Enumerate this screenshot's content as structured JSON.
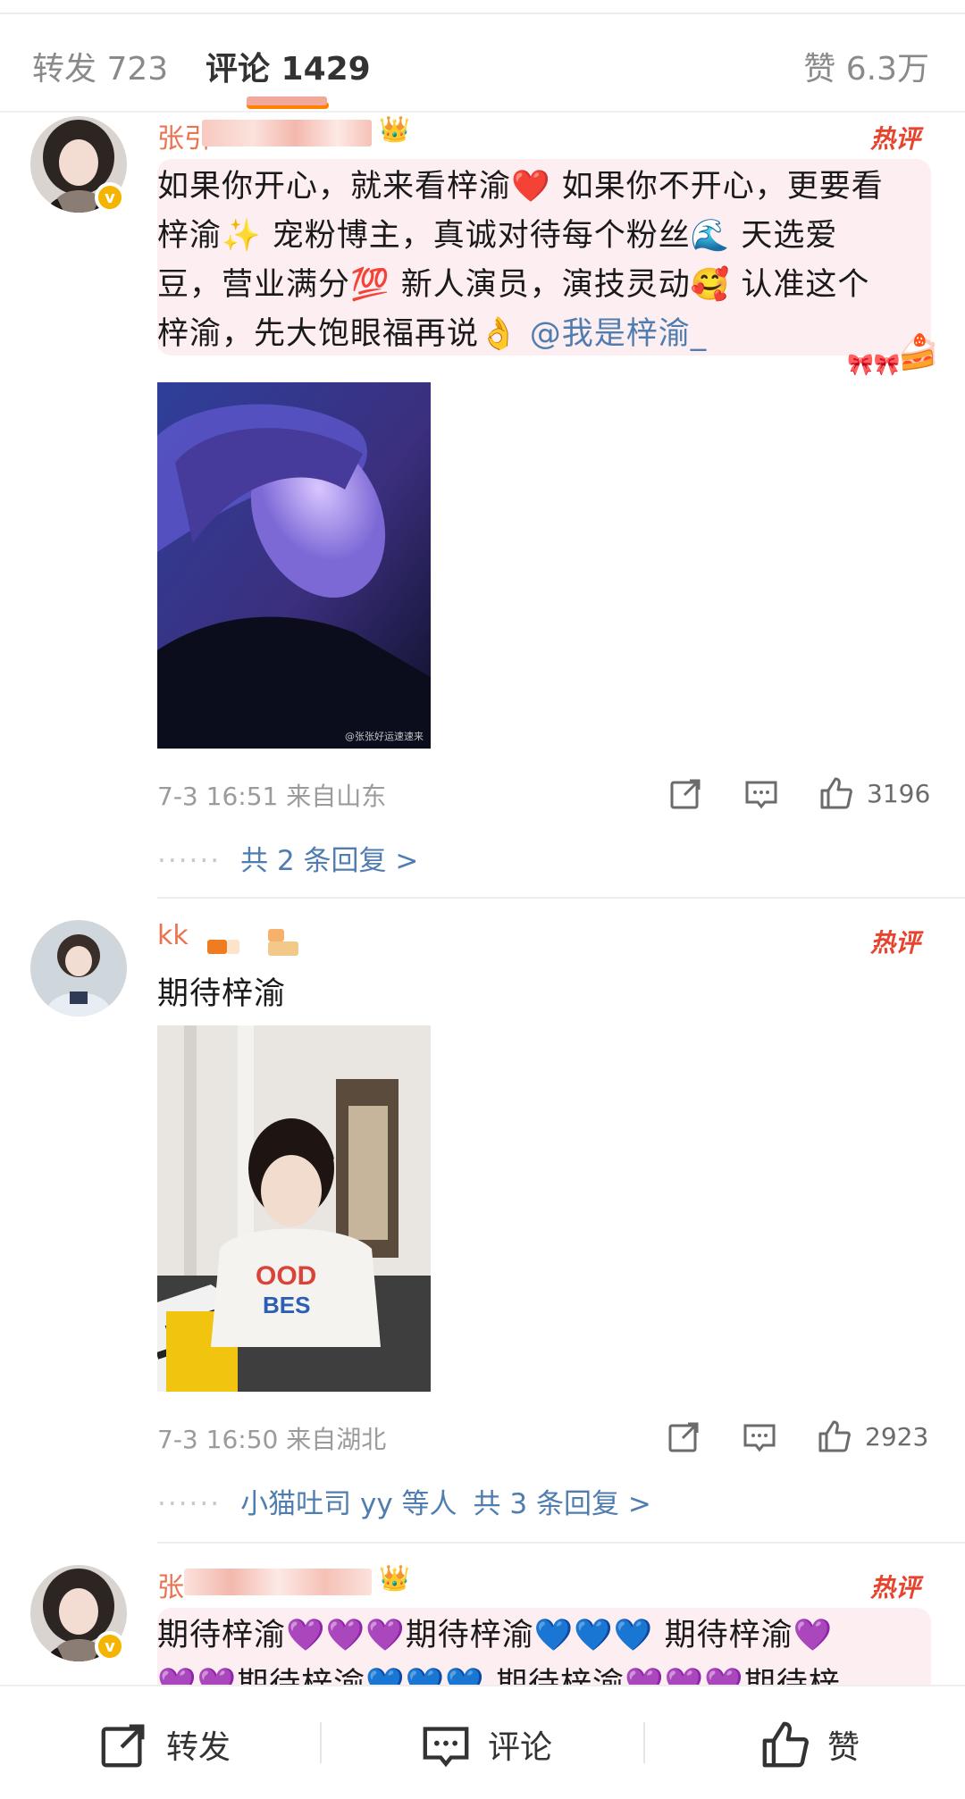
{
  "tabs": {
    "repost": "转发 723",
    "comment": "评论 1429",
    "like": "赞 6.3万"
  },
  "comments": [
    {
      "username_visible": "张引",
      "hot_label": "热评",
      "text_lines": [
        "如果你开心，就来看梓渝❤️ 如果你不开心，更要看",
        "梓渝✨ 宠粉博主，真诚对待每个粉丝🌊 天选爱",
        "豆，营业满分💯 新人演员，演技灵动🥰 认准这个"
      ],
      "text_last": "梓渝，先大饱眼福再说👌 ",
      "mention": "@我是梓渝_",
      "photo_caption": "@张张好运速速来",
      "time": "7-3 16:51 来自山东",
      "likes": "3196",
      "replies": "共 2 条回复 >"
    },
    {
      "username_visible": "kk",
      "hot_label": "热评",
      "text": "期待梓渝",
      "time": "7-3 16:50 来自湖北",
      "likes": "2923",
      "replies_users": "小猫吐司 yy 等人",
      "replies": "共 3 条回复 >"
    },
    {
      "username_visible": "张",
      "hot_label": "热评",
      "text_lines": [
        "期待梓渝💜💜💜期待梓渝💙💙💙 期待梓渝💜",
        "💜💜期待梓渝💙💙💙 期待梓渝💜💜💜期待梓"
      ]
    }
  ],
  "bottom_bar": {
    "repost": "转发",
    "comment": "评论",
    "like": "赞"
  },
  "colors": {
    "accent_orange": "#ff8200",
    "username": "#eb7350",
    "hot": "#e6442e",
    "link": "#507daf",
    "bubble": "#fdeef2"
  }
}
